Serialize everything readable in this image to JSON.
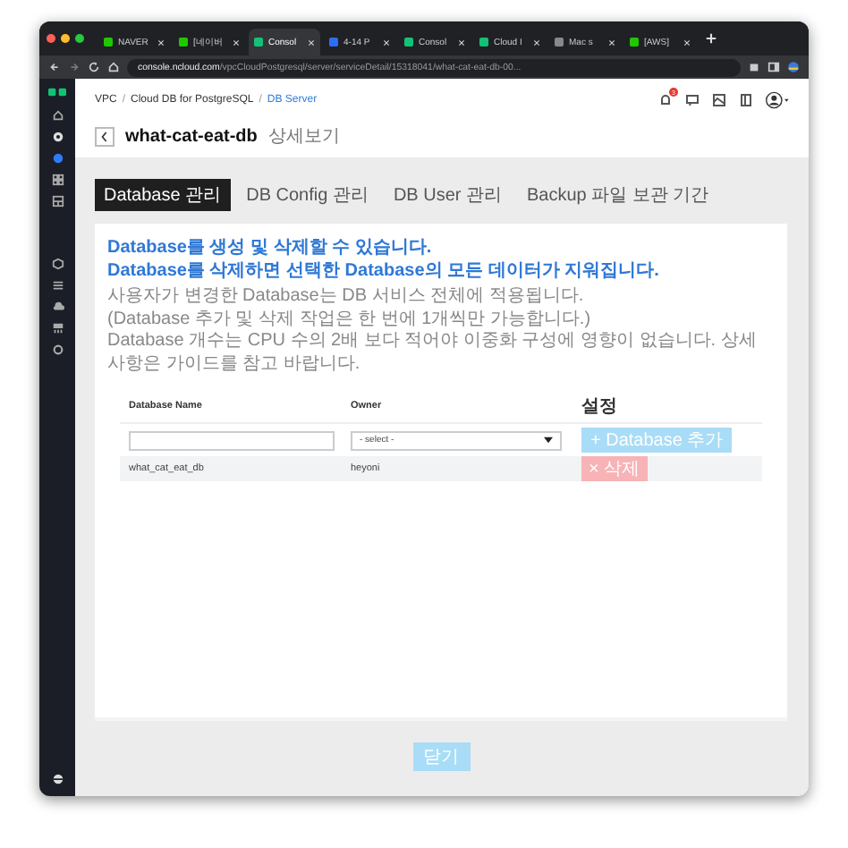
{
  "browser": {
    "tabs": [
      {
        "label": "NAVER",
        "selected": false,
        "color": "#1ec800"
      },
      {
        "label": "[네이버",
        "selected": false,
        "color": "#1ec800"
      },
      {
        "label": "Consol",
        "selected": true,
        "color": "#13c276"
      },
      {
        "label": "4-14 P",
        "selected": false,
        "color": "#2d6df6"
      },
      {
        "label": "Consol",
        "selected": false,
        "color": "#13c276"
      },
      {
        "label": "Cloud I",
        "selected": false,
        "color": "#13c276"
      },
      {
        "label": "Mac s",
        "selected": false,
        "color": "#888888"
      },
      {
        "label": "[AWS]",
        "selected": false,
        "color": "#1ec800"
      }
    ],
    "url_host": "console.ncloud.com",
    "url_path": "/vpcCloudPostgresql/server/serviceDetail/15318041/what-cat-eat-db-00..."
  },
  "header": {
    "notification_count": "3"
  },
  "breadcrumb": [
    {
      "kind": "link",
      "label": "VPC"
    },
    {
      "kind": "sep",
      "label": "/"
    },
    {
      "kind": "link",
      "label": "Cloud DB for PostgreSQL"
    },
    {
      "kind": "sep",
      "label": "/"
    },
    {
      "kind": "current",
      "label": "DB Server"
    }
  ],
  "page": {
    "title": "what-cat-eat-db",
    "subtitle": "상세보기"
  },
  "tabs": [
    {
      "label": "Database 관리",
      "selected": true
    },
    {
      "label": "DB Config 관리",
      "selected": false
    },
    {
      "label": "DB User 관리",
      "selected": false
    },
    {
      "label": "Backup 파일 보관 기간",
      "selected": false
    }
  ],
  "notice": [
    {
      "kind": "emphasis",
      "text": "Database를 생성 및 삭제할 수 있습니다."
    },
    {
      "kind": "emphasis",
      "text": "Database를 삭제하면 선택한 Database의 모든 데이터가 지워집니다."
    },
    {
      "kind": "note",
      "text": "사용자가 변경한 Database는 DB 서비스 전체에 적용됩니다."
    },
    {
      "kind": "note",
      "text": "(Database 추가 및 삭제 작업은 한 번에 1개씩만 가능합니다.)"
    },
    {
      "kind": "note",
      "text": "Database 개수는 CPU 수의 2배 보다 적어야 이중화 구성에 영향이 없습니다. 상세 사항은 가이드를 참고 바랍니다."
    }
  ],
  "table": {
    "columns": [
      "Database Name",
      "Owner",
      "설정"
    ],
    "new_row": {
      "owner_select": "- select -",
      "add_button": "+ Database 추가",
      "disabled": true
    },
    "rows": [
      {
        "name": "what_cat_eat_db",
        "owner": "heyoni",
        "action": "× 삭제",
        "disabled": true
      }
    ]
  },
  "footer": {
    "button": "닫기",
    "disabled": true
  }
}
